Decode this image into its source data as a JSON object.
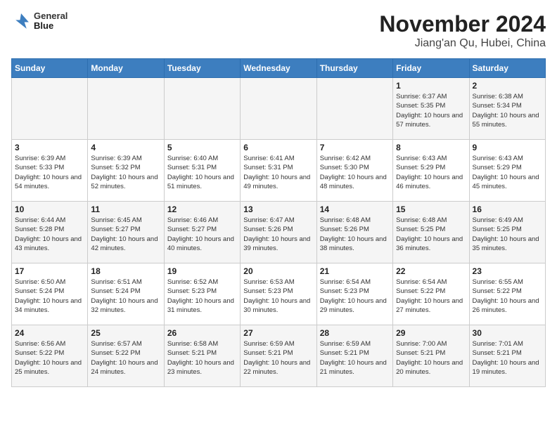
{
  "header": {
    "logo_line1": "General",
    "logo_line2": "Blue",
    "month": "November 2024",
    "location": "Jiang'an Qu, Hubei, China"
  },
  "weekdays": [
    "Sunday",
    "Monday",
    "Tuesday",
    "Wednesday",
    "Thursday",
    "Friday",
    "Saturday"
  ],
  "weeks": [
    [
      {
        "day": "",
        "info": ""
      },
      {
        "day": "",
        "info": ""
      },
      {
        "day": "",
        "info": ""
      },
      {
        "day": "",
        "info": ""
      },
      {
        "day": "",
        "info": ""
      },
      {
        "day": "1",
        "info": "Sunrise: 6:37 AM\nSunset: 5:35 PM\nDaylight: 10 hours and 57 minutes."
      },
      {
        "day": "2",
        "info": "Sunrise: 6:38 AM\nSunset: 5:34 PM\nDaylight: 10 hours and 55 minutes."
      }
    ],
    [
      {
        "day": "3",
        "info": "Sunrise: 6:39 AM\nSunset: 5:33 PM\nDaylight: 10 hours and 54 minutes."
      },
      {
        "day": "4",
        "info": "Sunrise: 6:39 AM\nSunset: 5:32 PM\nDaylight: 10 hours and 52 minutes."
      },
      {
        "day": "5",
        "info": "Sunrise: 6:40 AM\nSunset: 5:31 PM\nDaylight: 10 hours and 51 minutes."
      },
      {
        "day": "6",
        "info": "Sunrise: 6:41 AM\nSunset: 5:31 PM\nDaylight: 10 hours and 49 minutes."
      },
      {
        "day": "7",
        "info": "Sunrise: 6:42 AM\nSunset: 5:30 PM\nDaylight: 10 hours and 48 minutes."
      },
      {
        "day": "8",
        "info": "Sunrise: 6:43 AM\nSunset: 5:29 PM\nDaylight: 10 hours and 46 minutes."
      },
      {
        "day": "9",
        "info": "Sunrise: 6:43 AM\nSunset: 5:29 PM\nDaylight: 10 hours and 45 minutes."
      }
    ],
    [
      {
        "day": "10",
        "info": "Sunrise: 6:44 AM\nSunset: 5:28 PM\nDaylight: 10 hours and 43 minutes."
      },
      {
        "day": "11",
        "info": "Sunrise: 6:45 AM\nSunset: 5:27 PM\nDaylight: 10 hours and 42 minutes."
      },
      {
        "day": "12",
        "info": "Sunrise: 6:46 AM\nSunset: 5:27 PM\nDaylight: 10 hours and 40 minutes."
      },
      {
        "day": "13",
        "info": "Sunrise: 6:47 AM\nSunset: 5:26 PM\nDaylight: 10 hours and 39 minutes."
      },
      {
        "day": "14",
        "info": "Sunrise: 6:48 AM\nSunset: 5:26 PM\nDaylight: 10 hours and 38 minutes."
      },
      {
        "day": "15",
        "info": "Sunrise: 6:48 AM\nSunset: 5:25 PM\nDaylight: 10 hours and 36 minutes."
      },
      {
        "day": "16",
        "info": "Sunrise: 6:49 AM\nSunset: 5:25 PM\nDaylight: 10 hours and 35 minutes."
      }
    ],
    [
      {
        "day": "17",
        "info": "Sunrise: 6:50 AM\nSunset: 5:24 PM\nDaylight: 10 hours and 34 minutes."
      },
      {
        "day": "18",
        "info": "Sunrise: 6:51 AM\nSunset: 5:24 PM\nDaylight: 10 hours and 32 minutes."
      },
      {
        "day": "19",
        "info": "Sunrise: 6:52 AM\nSunset: 5:23 PM\nDaylight: 10 hours and 31 minutes."
      },
      {
        "day": "20",
        "info": "Sunrise: 6:53 AM\nSunset: 5:23 PM\nDaylight: 10 hours and 30 minutes."
      },
      {
        "day": "21",
        "info": "Sunrise: 6:54 AM\nSunset: 5:23 PM\nDaylight: 10 hours and 29 minutes."
      },
      {
        "day": "22",
        "info": "Sunrise: 6:54 AM\nSunset: 5:22 PM\nDaylight: 10 hours and 27 minutes."
      },
      {
        "day": "23",
        "info": "Sunrise: 6:55 AM\nSunset: 5:22 PM\nDaylight: 10 hours and 26 minutes."
      }
    ],
    [
      {
        "day": "24",
        "info": "Sunrise: 6:56 AM\nSunset: 5:22 PM\nDaylight: 10 hours and 25 minutes."
      },
      {
        "day": "25",
        "info": "Sunrise: 6:57 AM\nSunset: 5:22 PM\nDaylight: 10 hours and 24 minutes."
      },
      {
        "day": "26",
        "info": "Sunrise: 6:58 AM\nSunset: 5:21 PM\nDaylight: 10 hours and 23 minutes."
      },
      {
        "day": "27",
        "info": "Sunrise: 6:59 AM\nSunset: 5:21 PM\nDaylight: 10 hours and 22 minutes."
      },
      {
        "day": "28",
        "info": "Sunrise: 6:59 AM\nSunset: 5:21 PM\nDaylight: 10 hours and 21 minutes."
      },
      {
        "day": "29",
        "info": "Sunrise: 7:00 AM\nSunset: 5:21 PM\nDaylight: 10 hours and 20 minutes."
      },
      {
        "day": "30",
        "info": "Sunrise: 7:01 AM\nSunset: 5:21 PM\nDaylight: 10 hours and 19 minutes."
      }
    ]
  ]
}
